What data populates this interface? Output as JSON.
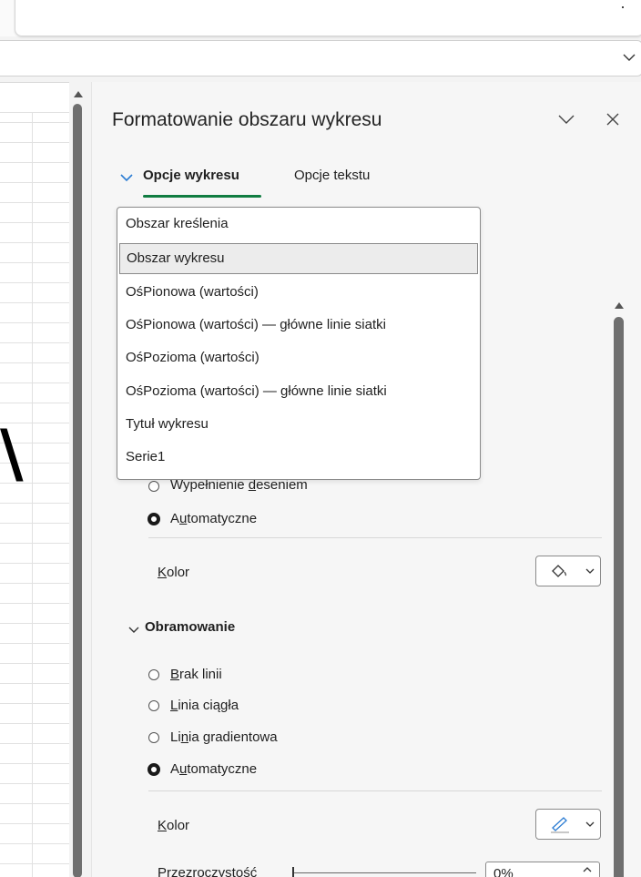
{
  "pane": {
    "title": "Formatowanie obszaru wykresu",
    "tabs": [
      {
        "label": "Opcje wykresu"
      },
      {
        "label": "Opcje tekstu"
      }
    ]
  },
  "dropdown": {
    "items": [
      "Obszar kreślenia",
      "Obszar wykresu",
      "OśPionowa (wartości)",
      "OśPionowa (wartości)  — główne linie siatki",
      "OśPozioma (wartości)",
      "OśPozioma (wartości)  — główne linie siatki",
      "Tytuł wykresu",
      "Serie1"
    ],
    "selected": "Obszar wykresu"
  },
  "fill": {
    "pattern_label_pre": "Wypełnienie ",
    "pattern_label_u": "d",
    "pattern_label_post": "eseniem",
    "auto_label_pre": "A",
    "auto_label_u": "u",
    "auto_label_post": "tomatyczne",
    "color_label_u": "K",
    "color_label_post": "olor"
  },
  "border": {
    "section_title": "Obramowanie",
    "no_line_u": "B",
    "no_line_post": "rak linii",
    "solid_u": "L",
    "solid_post": "inia ciągła",
    "gradient_pre": "Li",
    "gradient_u": "n",
    "gradient_post": "ia gradientowa",
    "auto_pre": "A",
    "auto_u": "u",
    "auto_post": "tomatyczne",
    "color_u": "K",
    "color_post": "olor",
    "transparency_label": "Przezroczystość",
    "transparency_value": "0%"
  },
  "glyph": "\\",
  "colors": {
    "accent": "#107c41",
    "scrollbar": "#6f6f6f"
  },
  "icons": [
    "chevron-down-icon",
    "close-icon",
    "paint-bucket-icon",
    "pen-icon",
    "scroll-up-arrow-icon"
  ]
}
